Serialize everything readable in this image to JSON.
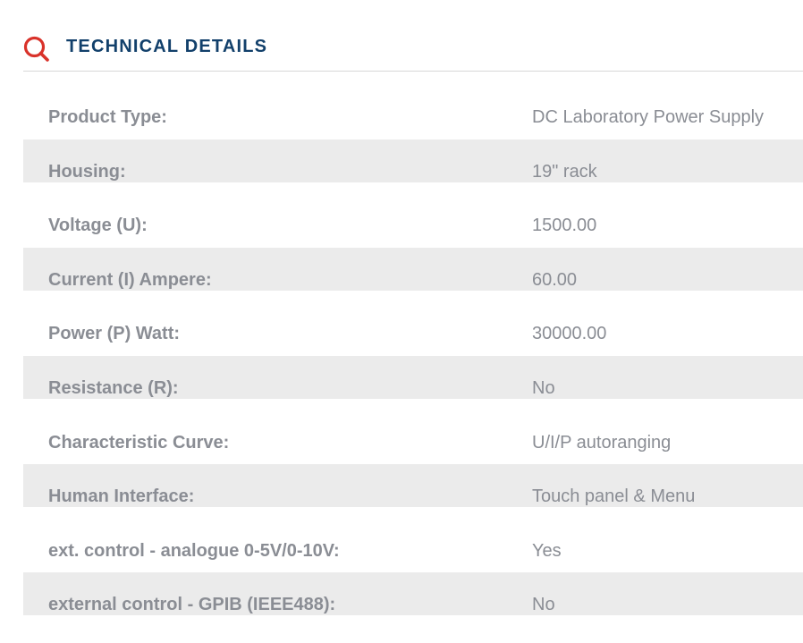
{
  "section": {
    "title": "TECHNICAL DETAILS",
    "icon": "search-icon",
    "colors": {
      "title": "#12406b",
      "icon": "#d9322a",
      "text": "#8a8d94",
      "row_shade": "#ebebeb",
      "divider": "#d7d7d7"
    }
  },
  "details": [
    {
      "label": "Product Type:",
      "value": "DC Laboratory Power Supply"
    },
    {
      "label": "Housing:",
      "value": "19\" rack"
    },
    {
      "label": "Voltage (U):",
      "value": "1500.00"
    },
    {
      "label": "Current (I) Ampere:",
      "value": "60.00"
    },
    {
      "label": "Power (P) Watt:",
      "value": "30000.00"
    },
    {
      "label": "Resistance (R):",
      "value": "No"
    },
    {
      "label": "Characteristic Curve:",
      "value": "U/I/P autoranging"
    },
    {
      "label": "Human Interface:",
      "value": "Touch panel & Menu"
    },
    {
      "label": "ext. control - analogue 0-5V/0-10V:",
      "value": "Yes"
    },
    {
      "label": "external control - GPIB (IEEE488):",
      "value": "No"
    }
  ]
}
